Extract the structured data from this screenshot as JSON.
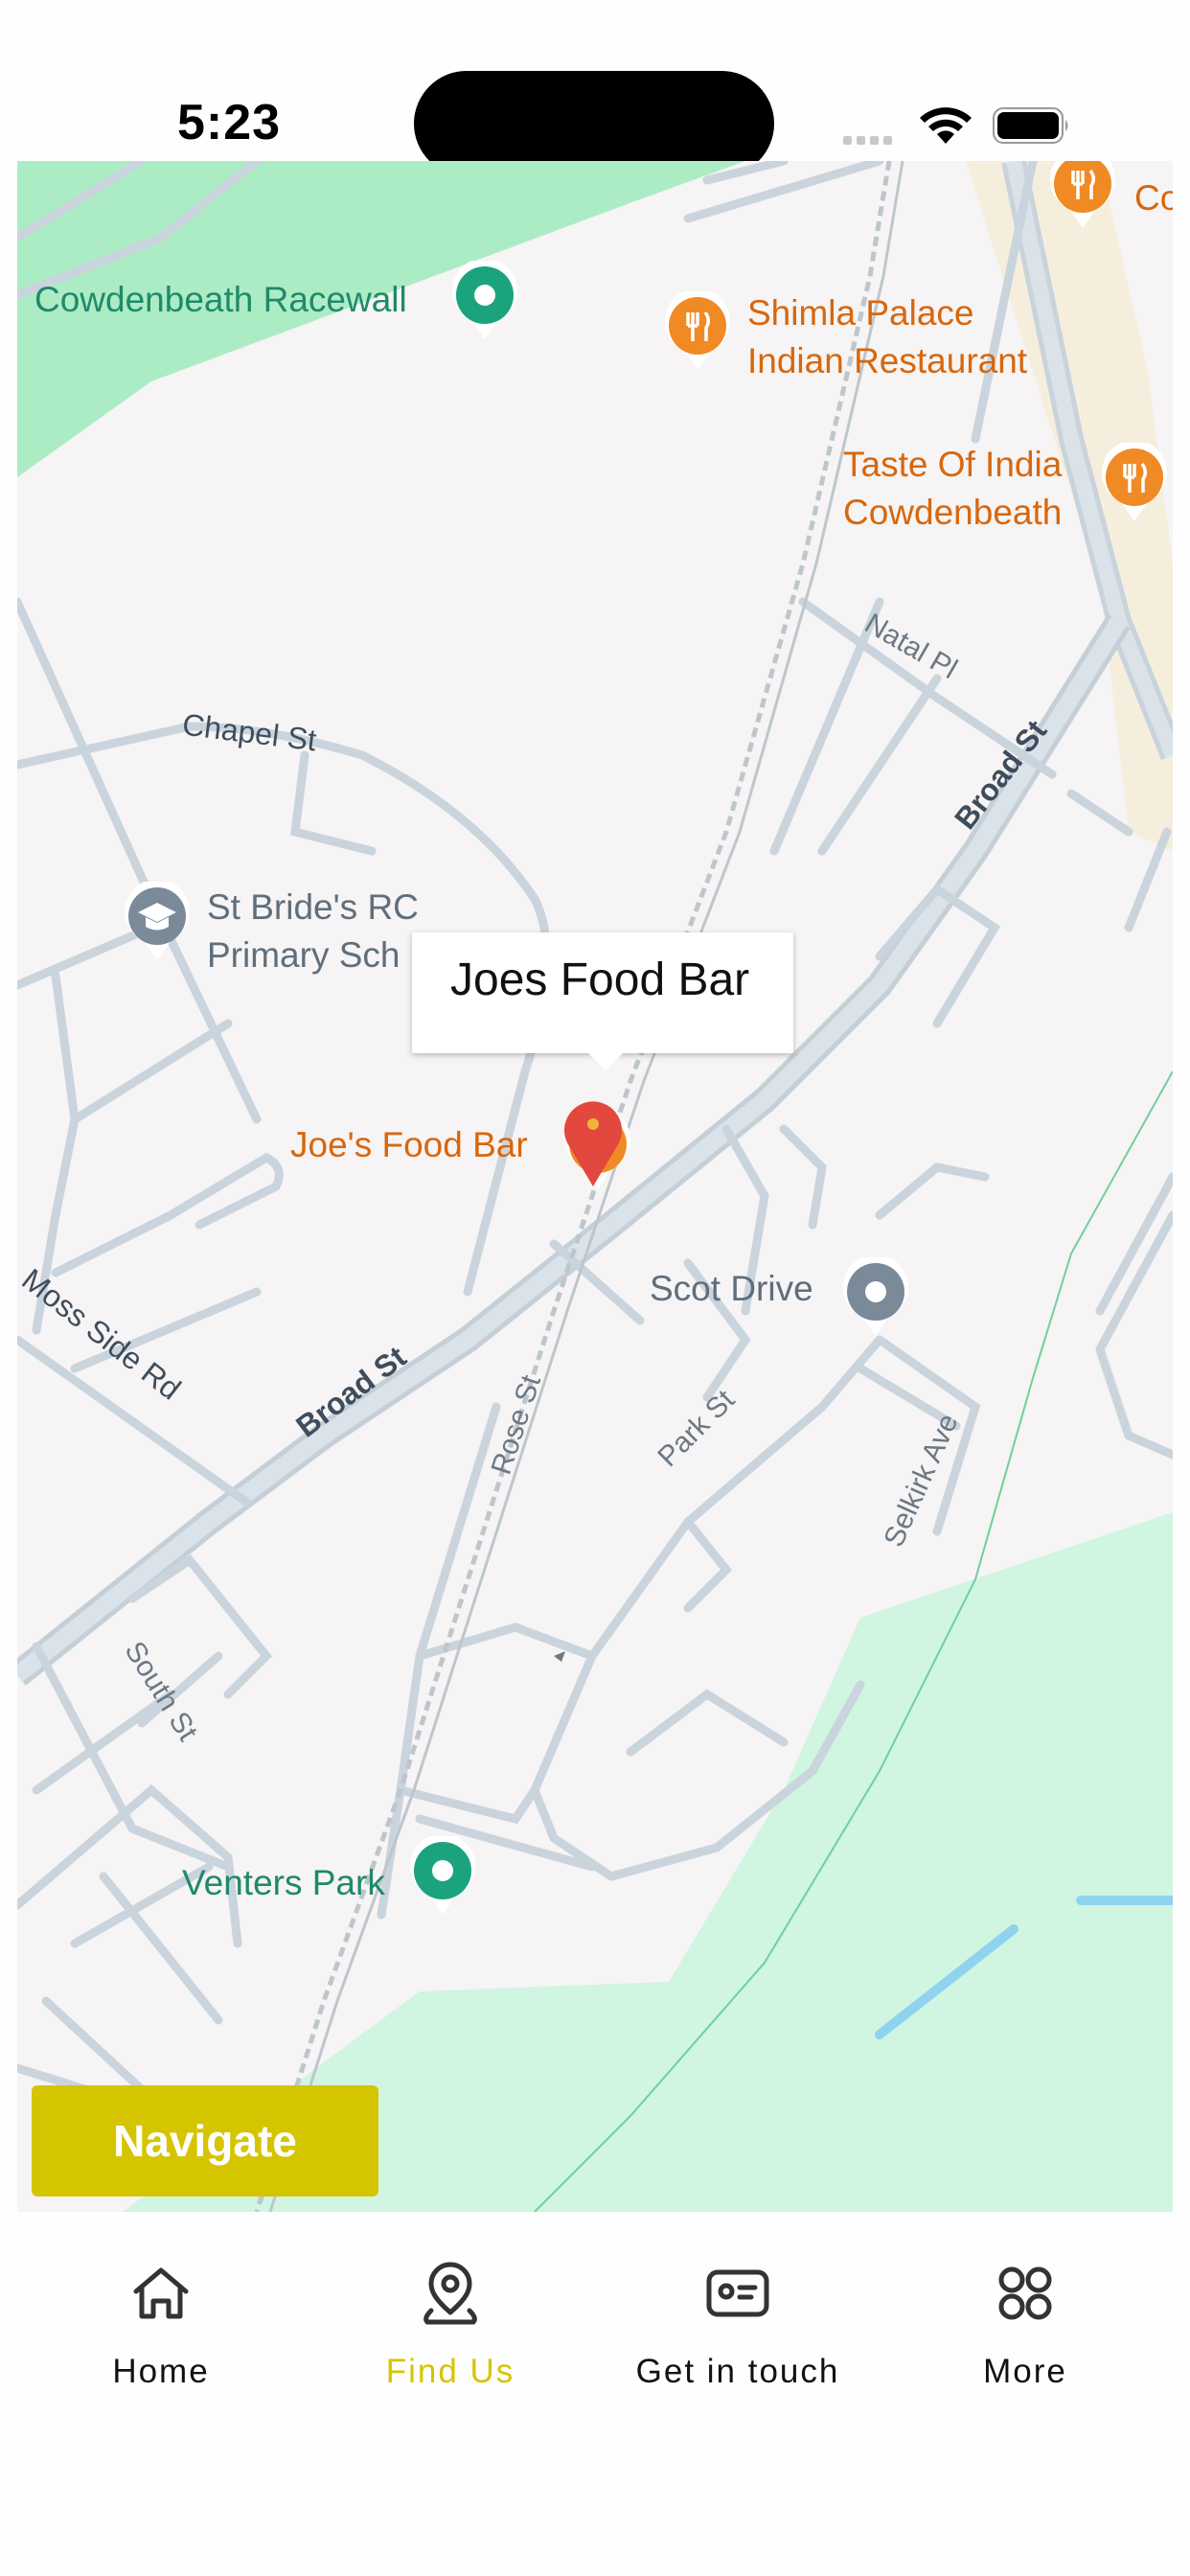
{
  "status_bar": {
    "time": "5:23"
  },
  "map": {
    "places": {
      "racewall": "Cowdenbeath Racewall",
      "shimla_line1": "Shimla Palace",
      "shimla_line2": "Indian Restaurant",
      "taste_line1": "Taste Of India",
      "taste_line2": "Cowdenbeath",
      "school_line1": "St Bride's RC",
      "school_line2": "Primary Sch",
      "joes": "Joe's Food Bar",
      "scot_drive": "Scot Drive",
      "venters_park": "Venters Park",
      "partial_label": "Co"
    },
    "streets": {
      "chapel_st": "Chapel St",
      "natal_pl": "Natal Pl",
      "broad_st_upper": "Broad St",
      "broad_st_lower": "Broad St",
      "moss_side_rd": "Moss Side Rd",
      "rose_st": "Rose St",
      "park_st": "Park St",
      "selkirk_ave": "Selkirk Ave",
      "south_st": "South St"
    },
    "callout": "Joes Food Bar"
  },
  "navigate_label": "Navigate",
  "tabs": [
    {
      "label": "Home",
      "icon": "home-icon"
    },
    {
      "label": "Find Us",
      "icon": "location-pin-icon",
      "active": true
    },
    {
      "label": "Get in touch",
      "icon": "contact-card-icon"
    },
    {
      "label": "More",
      "icon": "grid-icon"
    }
  ],
  "colors": {
    "accent": "#d5c500",
    "pin_red": "#e2483d",
    "poi_orange": "#f08a24",
    "poi_green": "#1ba37e",
    "park_green": "#d0f5e1"
  }
}
